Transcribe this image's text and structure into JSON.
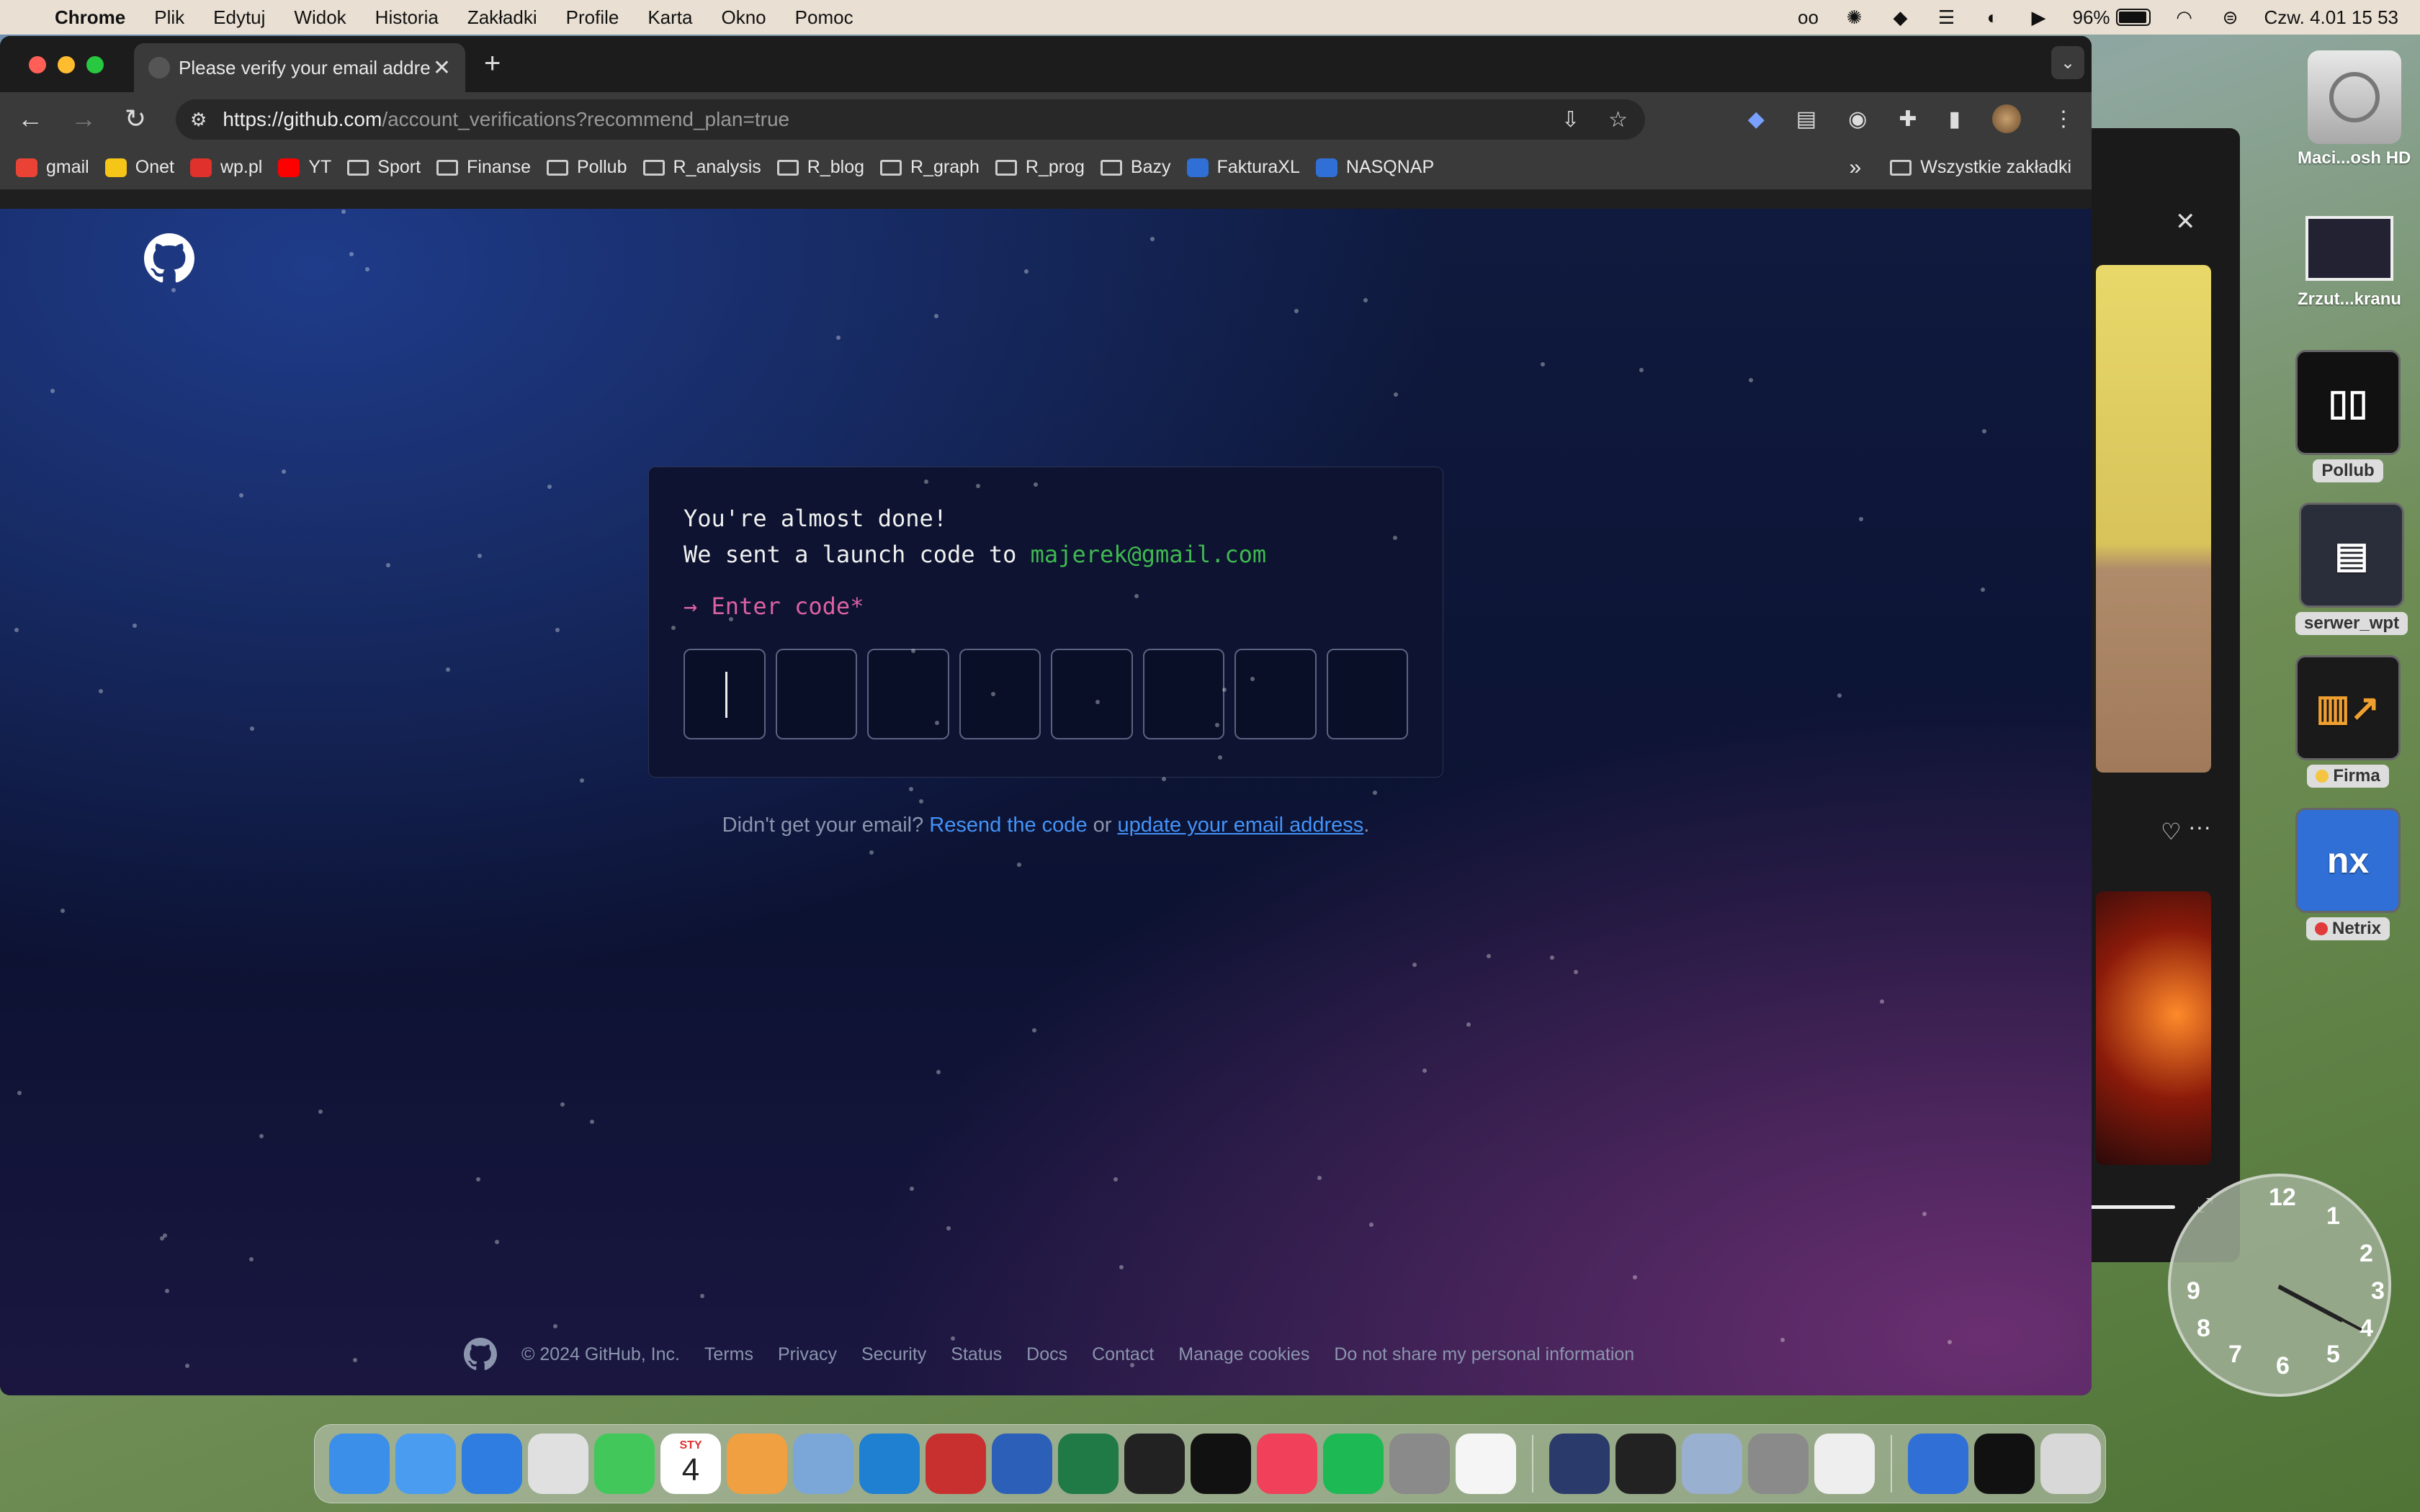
{
  "menubar": {
    "app": "Chrome",
    "items": [
      "Plik",
      "Edytuj",
      "Widok",
      "Historia",
      "Zakładki",
      "Profile",
      "Karta",
      "Okno",
      "Pomoc"
    ],
    "battery": "96%",
    "battery_level": 0.96,
    "datetime": "Czw. 4.01  15 53"
  },
  "desktop": {
    "drive": "Maci...osh HD",
    "screenshot": "Zrzut...kranu",
    "items": [
      {
        "label": "Pollub",
        "icon": "pollub-icon"
      },
      {
        "label": "serwer_wpt",
        "icon": "server-icon"
      },
      {
        "label": "Firma",
        "icon": "building-chart-icon",
        "dot": "#f5c542"
      },
      {
        "label": "Netrix",
        "icon": "nx-icon",
        "dot": "#e03a3a",
        "text": "nx"
      }
    ]
  },
  "clock": {
    "numerals": [
      "12",
      "1",
      "2",
      "3",
      "4",
      "5",
      "6",
      "7",
      "8",
      "9"
    ]
  },
  "chrome": {
    "tab_title": "Please verify your email addre",
    "url_host": "https://github.com",
    "url_path": "/account_verifications?recommend_plan=true",
    "bookmarks": [
      {
        "label": "gmail",
        "icon": "gmail-icon",
        "color": "#ea4335"
      },
      {
        "label": "Onet",
        "icon": "onet-icon",
        "color": "#f5c518"
      },
      {
        "label": "wp.pl",
        "icon": "wp-icon",
        "color": "#e0312c"
      },
      {
        "label": "YT",
        "icon": "youtube-icon",
        "color": "#ff0000"
      },
      {
        "label": "Sport",
        "icon": "folder-icon"
      },
      {
        "label": "Finanse",
        "icon": "folder-icon"
      },
      {
        "label": "Pollub",
        "icon": "folder-icon"
      },
      {
        "label": "R_analysis",
        "icon": "folder-icon"
      },
      {
        "label": "R_blog",
        "icon": "folder-icon"
      },
      {
        "label": "R_graph",
        "icon": "folder-icon"
      },
      {
        "label": "R_prog",
        "icon": "folder-icon"
      },
      {
        "label": "Bazy",
        "icon": "folder-icon"
      },
      {
        "label": "FakturaXL",
        "icon": "fakturaxl-icon",
        "color": "#2f6fd6"
      },
      {
        "label": "NASQNAP",
        "icon": "nasqnap-icon",
        "color": "#2f6fd6"
      }
    ],
    "all_bookmarks": "Wszystkie zakładki"
  },
  "verify": {
    "line1": "You're almost done!",
    "line2_prefix": "We sent a launch code to ",
    "email": "majerek@gmail.com",
    "prompt": "→ Enter code*",
    "code_boxes": 8,
    "help_prefix": "Didn't get your email? ",
    "resend": "Resend the code",
    "or": " or ",
    "update": "update your email address",
    "period": "."
  },
  "footer": {
    "copyright": "© 2024 GitHub, Inc.",
    "links": [
      "Terms",
      "Privacy",
      "Security",
      "Status",
      "Docs",
      "Contact",
      "Manage cookies",
      "Do not share my personal information"
    ]
  },
  "dock": {
    "calendar_month": "STY",
    "calendar_day": "4",
    "apps": [
      {
        "name": "finder-icon",
        "color": "#3b8fe8"
      },
      {
        "name": "mail-icon",
        "color": "#4a9cf0"
      },
      {
        "name": "safari-icon",
        "color": "#2f7de0"
      },
      {
        "name": "chrome-icon",
        "color": "#e0e0e0"
      },
      {
        "name": "messages-icon",
        "color": "#42c85a"
      },
      {
        "name": "calendar-icon",
        "color": "#ffffff"
      },
      {
        "name": "photos-icon",
        "color": "#f0a040"
      },
      {
        "name": "rstudio-icon",
        "color": "#7aa6d8"
      },
      {
        "name": "vscode-icon",
        "color": "#1f7fd0"
      },
      {
        "name": "zotero-icon",
        "color": "#c8302f"
      },
      {
        "name": "word-icon",
        "color": "#2b5fb8"
      },
      {
        "name": "excel-icon",
        "color": "#1f7a45"
      },
      {
        "name": "terminal-icon",
        "color": "#222222"
      },
      {
        "name": "appletv-icon",
        "color": "#111111"
      },
      {
        "name": "music-icon",
        "color": "#f0405a"
      },
      {
        "name": "spotify-icon",
        "color": "#1db954"
      },
      {
        "name": "settings-icon",
        "color": "#8a8a8a"
      },
      {
        "name": "chatgpt-icon",
        "color": "#f5f5f5"
      },
      {
        "name": "vpn-icon",
        "color": "#2a3a6a"
      },
      {
        "name": "activity-monitor-icon",
        "color": "#222222"
      },
      {
        "name": "preview-icon",
        "color": "#9ab0d0"
      },
      {
        "name": "tex-icon",
        "color": "#8a8a8a"
      },
      {
        "name": "textedit-icon",
        "color": "#eeeeee"
      },
      {
        "name": "netrix-icon",
        "color": "#2f6fd6"
      },
      {
        "name": "pollub-icon",
        "color": "#111111"
      },
      {
        "name": "trash-icon",
        "color": "#d8d8d8"
      }
    ]
  }
}
